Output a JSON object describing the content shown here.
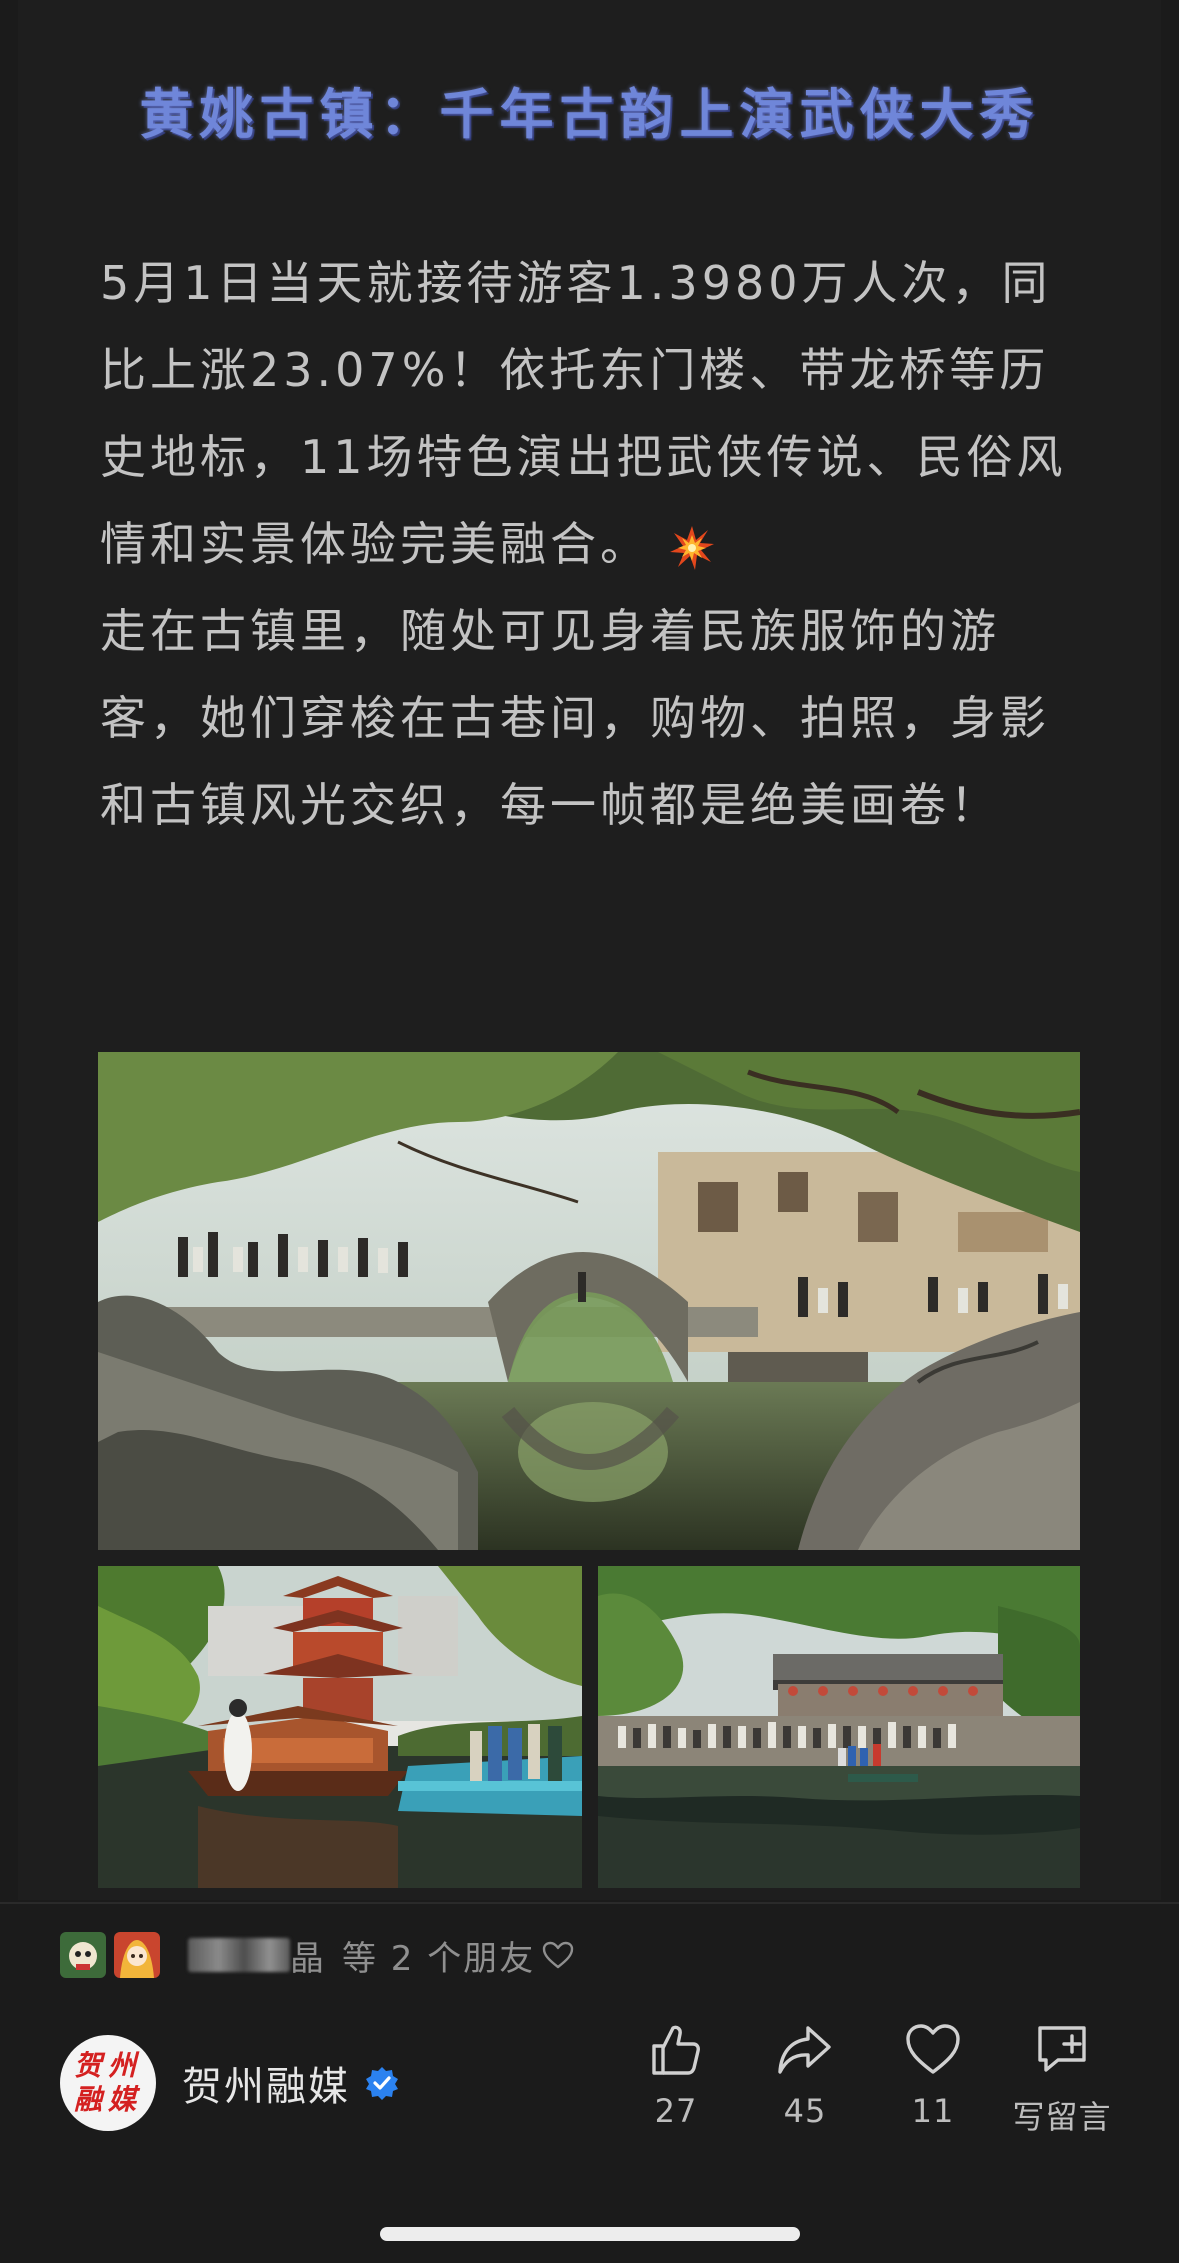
{
  "article": {
    "title": "黄姚古镇：千年古韵上演武侠大秀",
    "paragraph_1": "5月1日当天就接待游客1.3980万人次，同比上涨23.07%！依托东门楼、带龙桥等历史地标，11场特色演出把武侠传说、民俗风情和实景体验完美融合。",
    "paragraph_1_emoji": "collision-spark-icon",
    "paragraph_2": "走在古镇里，随处可见身着民族服饰的游客，她们穿梭在古巷间，购物、拍照，身影和古镇风光交织，每一帧都是绝美画卷！"
  },
  "friends": {
    "name_blur_tail": "晶",
    "text": "等 2 个朋友"
  },
  "account": {
    "avatar_text": "贺州融媒",
    "name": "贺州融媒"
  },
  "actions": {
    "like_count": "27",
    "share_count": "45",
    "favorite_count": "11",
    "comment_label": "写留言"
  },
  "colors": {
    "title": "#6f86d9",
    "body_text": "#c3c3c3",
    "verified": "#2b82f0",
    "background": "#1b1b1b"
  }
}
